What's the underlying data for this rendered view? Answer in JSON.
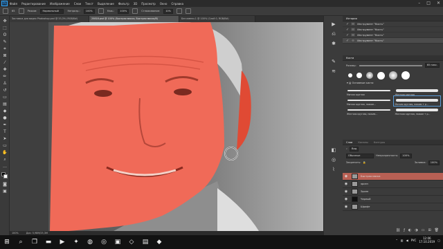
{
  "menu": {
    "app_logo": "Ps",
    "items": [
      "Файл",
      "Редактирование",
      "Изображение",
      "Слои",
      "Текст",
      "Выделение",
      "Фильтр",
      "3D",
      "Просмотр",
      "Окно",
      "Справка"
    ]
  },
  "options_bar": {
    "size": "65",
    "mode_label": "Режим:",
    "mode_value": "Нормальный",
    "opacity_label": "Непрозр.:",
    "opacity_value": "100%",
    "flow_label": "Наж.:",
    "flow_value": "100%",
    "smooth_label": "Сглаживание:",
    "smooth_value": "10%"
  },
  "tabs": [
    {
      "label": "Заставка для видео Photoshop.psd @ 33,3% (RGB/8#)",
      "active": false
    },
    {
      "label": "25818.psd @ 100% (Быстрая маска, Быстрая маска/8)",
      "active": true
    },
    {
      "label": "Без имени-1 @ 100% (Слой 0, RGB/8#)",
      "active": false
    }
  ],
  "status": {
    "zoom": "100%",
    "doc": "Док: 5,98М/25,3М"
  },
  "history": {
    "title": "История",
    "items": [
      {
        "label": "Инструмент \"Кисть\"",
        "selected": false
      },
      {
        "label": "Инструмент \"Кисть\"",
        "selected": false
      },
      {
        "label": "Инструмент \"Кисть\"",
        "selected": false
      },
      {
        "label": "Инструмент \"Кисть\"",
        "selected": true
      }
    ]
  },
  "brushes": {
    "title": "Кисти",
    "size_label": "Размер:",
    "size_value": "65 пикс.",
    "group_label": "Основные кисти",
    "presets": [
      {
        "left": "Мягкая круглая",
        "right": "Жесткая круглая",
        "right_selected": false
      },
      {
        "left": "Мягкая круглая, нажим…",
        "right": "Мягкая круглая, нажим + р…",
        "right_selected": true
      },
      {
        "left": "Жесткая круглая, нажим…",
        "right": "Жесткая круглая, нажим + р…",
        "right_selected": false
      },
      {
        "left": "Мягкая круглая, нажим + р…",
        "right": "Мягкая круглая, нажим…",
        "right_selected": false
      }
    ]
  },
  "layers": {
    "tabs": [
      "Слои",
      "Каналы",
      "Контуры"
    ],
    "filter_label": "Вид",
    "blend_mode": "Обычные",
    "opacity_label": "Непрозрачность:",
    "opacity_value": "100%",
    "lock_label": "Закрепить:",
    "fill_label": "Заливка:",
    "fill_value": "100%",
    "items": [
      {
        "name": "Быстрая маска",
        "selected": true
      },
      {
        "name": "эрсен",
        "selected": false
      },
      {
        "name": "Эрсен",
        "selected": false
      },
      {
        "name": "Черный",
        "selected": false
      },
      {
        "name": "Шрифт",
        "selected": false
      }
    ]
  },
  "taskbar": {
    "time": "12:06",
    "date": "17.10.2019",
    "lang": "РУС"
  }
}
